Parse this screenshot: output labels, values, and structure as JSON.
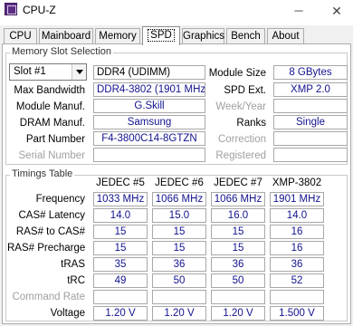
{
  "window": {
    "title": "CPU-Z",
    "minimize_glyph": "─",
    "close_glyph": "✕"
  },
  "tabs": [
    {
      "label": "CPU"
    },
    {
      "label": "Mainboard"
    },
    {
      "label": "Memory"
    },
    {
      "label": "SPD",
      "active": true
    },
    {
      "label": "Graphics"
    },
    {
      "label": "Bench"
    },
    {
      "label": "About"
    }
  ],
  "slot": {
    "group_title": "Memory Slot Selection",
    "selected": "Slot #1",
    "type": "DDR4 (UDIMM)",
    "labels": {
      "module_size": "Module Size",
      "max_bandwidth": "Max Bandwidth",
      "spd_ext": "SPD Ext.",
      "module_manuf": "Module Manuf.",
      "week_year": "Week/Year",
      "dram_manuf": "DRAM Manuf.",
      "ranks": "Ranks",
      "part_number": "Part Number",
      "correction": "Correction",
      "serial_number": "Serial Number",
      "registered": "Registered"
    },
    "values": {
      "module_size": "8 GBytes",
      "max_bandwidth": "DDR4-3802 (1901 MHz)",
      "spd_ext": "XMP 2.0",
      "module_manuf": "G.Skill",
      "week_year": "",
      "dram_manuf": "Samsung",
      "ranks": "Single",
      "part_number": "F4-3800C14-8GTZN",
      "correction": "",
      "serial_number": "",
      "registered": ""
    }
  },
  "timings": {
    "group_title": "Timings Table",
    "columns": [
      "JEDEC #5",
      "JEDEC #6",
      "JEDEC #7",
      "XMP-3802"
    ],
    "rows": [
      {
        "label": "Frequency",
        "values": [
          "1033 MHz",
          "1066 MHz",
          "1066 MHz",
          "1901 MHz"
        ],
        "dim": false
      },
      {
        "label": "CAS# Latency",
        "values": [
          "14.0",
          "15.0",
          "16.0",
          "14.0"
        ],
        "dim": false
      },
      {
        "label": "RAS# to CAS#",
        "values": [
          "15",
          "15",
          "15",
          "16"
        ],
        "dim": false
      },
      {
        "label": "RAS# Precharge",
        "values": [
          "15",
          "15",
          "15",
          "16"
        ],
        "dim": false
      },
      {
        "label": "tRAS",
        "values": [
          "35",
          "36",
          "36",
          "36"
        ],
        "dim": false
      },
      {
        "label": "tRC",
        "values": [
          "49",
          "50",
          "50",
          "52"
        ],
        "dim": false
      },
      {
        "label": "Command Rate",
        "values": [
          "",
          "",
          "",
          ""
        ],
        "dim": true
      },
      {
        "label": "Voltage",
        "values": [
          "1.20 V",
          "1.20 V",
          "1.20 V",
          "1.500 V"
        ],
        "dim": false
      }
    ]
  }
}
